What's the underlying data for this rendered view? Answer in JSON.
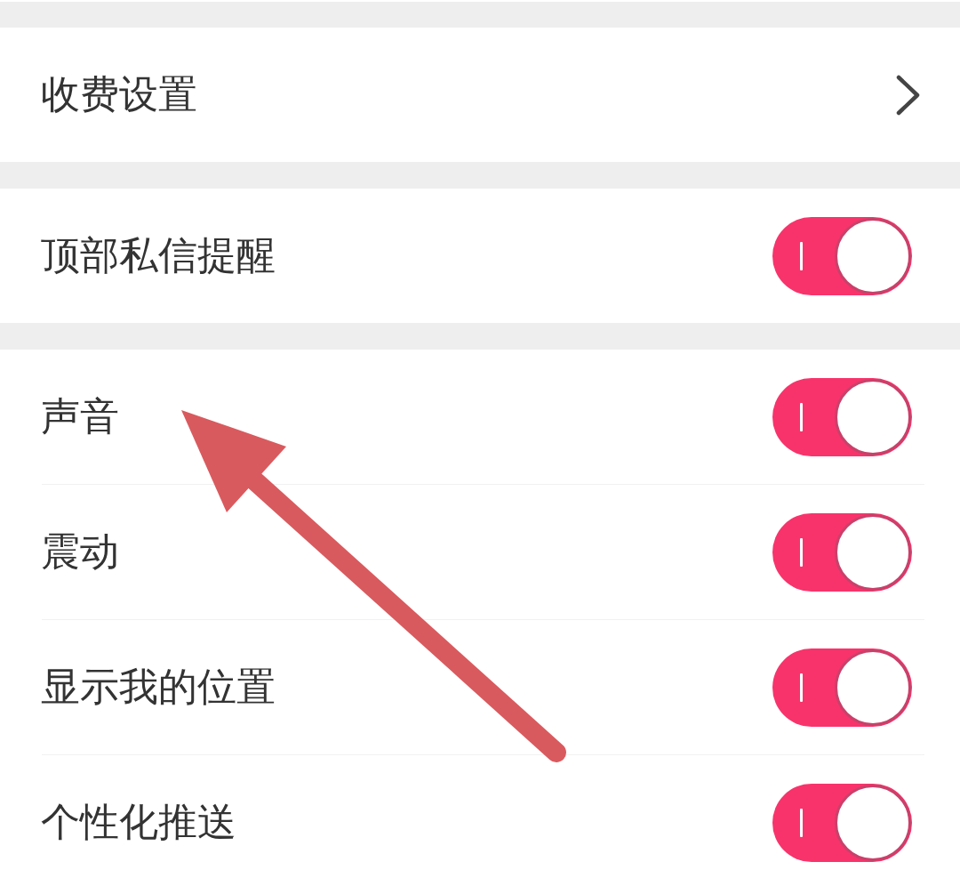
{
  "sections": [
    {
      "items": [
        {
          "kind": "link",
          "label": "收费设置"
        }
      ]
    },
    {
      "items": [
        {
          "kind": "toggle",
          "label": "顶部私信提醒",
          "on": true
        }
      ]
    },
    {
      "items": [
        {
          "kind": "toggle",
          "label": "声音",
          "on": true
        },
        {
          "kind": "toggle",
          "label": "震动",
          "on": true
        },
        {
          "kind": "toggle",
          "label": "显示我的位置",
          "on": true
        },
        {
          "kind": "toggle",
          "label": "个性化推送",
          "on": true
        }
      ]
    }
  ]
}
